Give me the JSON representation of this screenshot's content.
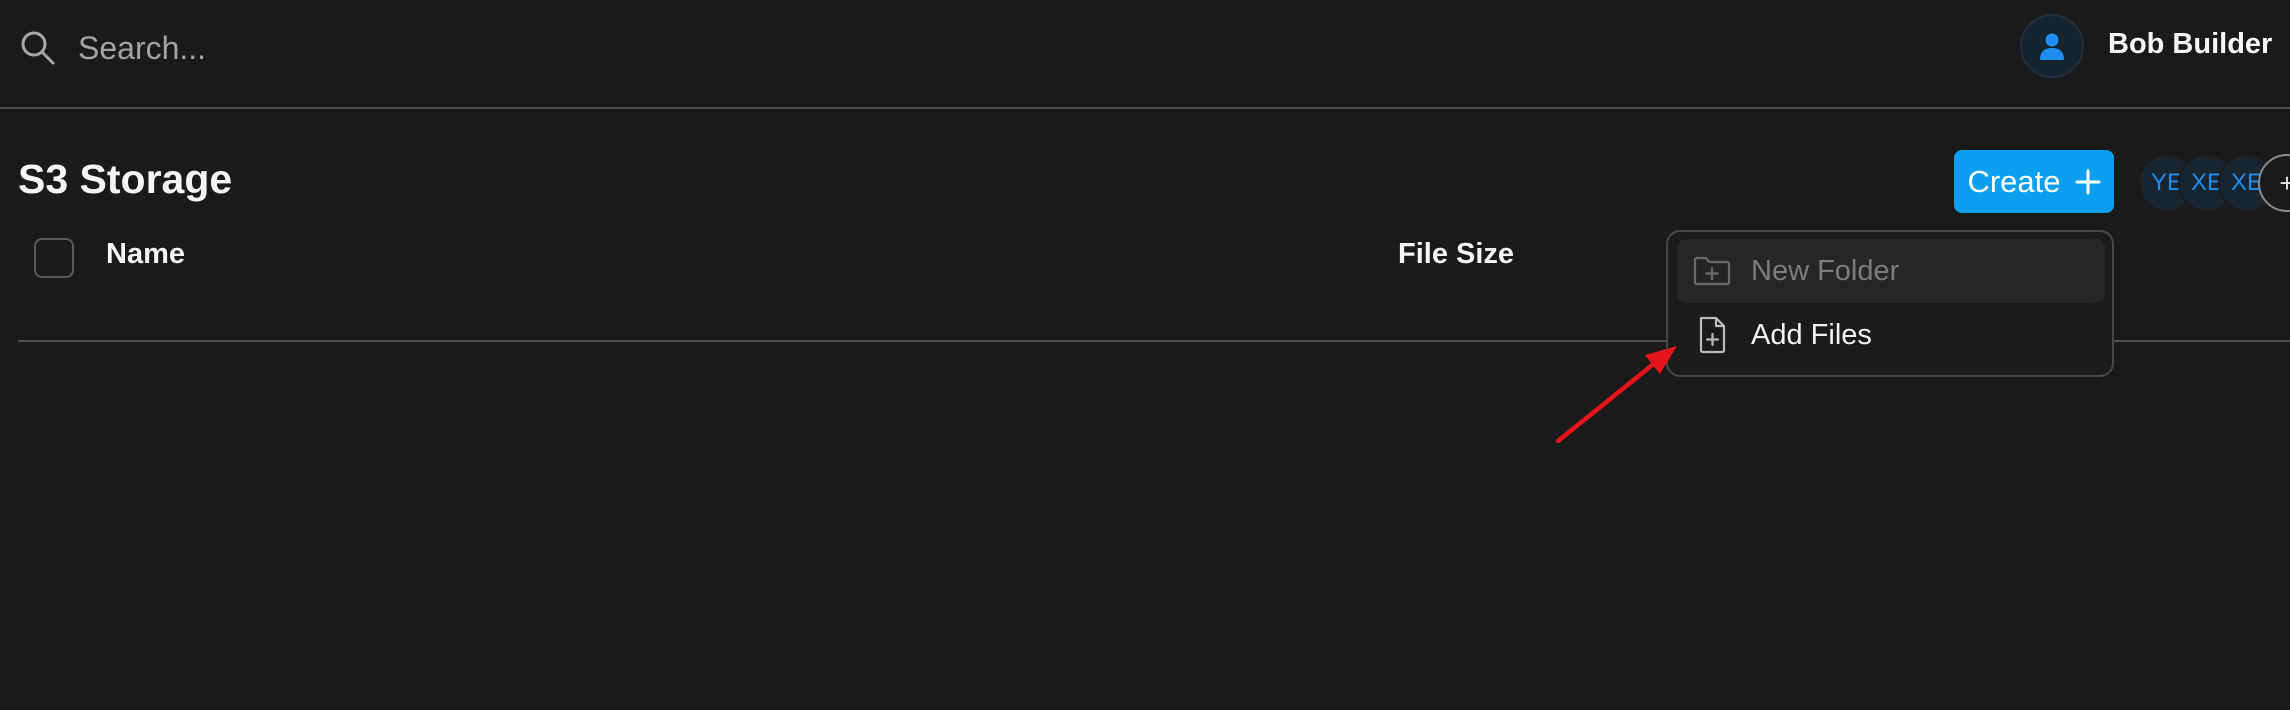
{
  "header": {
    "search": {
      "placeholder": "Search...",
      "value": "",
      "icon": "search-icon"
    },
    "user": {
      "name": "Bob Builder",
      "avatar_icon": "user-icon",
      "avatar_color": "#1d8ff0"
    }
  },
  "page": {
    "title": "S3 Storage",
    "create_button": {
      "label": "Create",
      "icon": "plus-icon",
      "color": "#0ba0ef"
    },
    "avatars": [
      "YE",
      "XE",
      "XE"
    ],
    "avatars_more_label": "+"
  },
  "table": {
    "columns": [
      "Name",
      "File Size"
    ],
    "rows": []
  },
  "create_menu": {
    "items": [
      {
        "label": "New Folder",
        "icon": "folder-plus-icon",
        "disabled": true
      },
      {
        "label": "Add Files",
        "icon": "file-plus-icon",
        "disabled": false
      }
    ]
  },
  "annotation": {
    "type": "arrow",
    "color": "#e8141b",
    "points_to": "Add Files"
  }
}
